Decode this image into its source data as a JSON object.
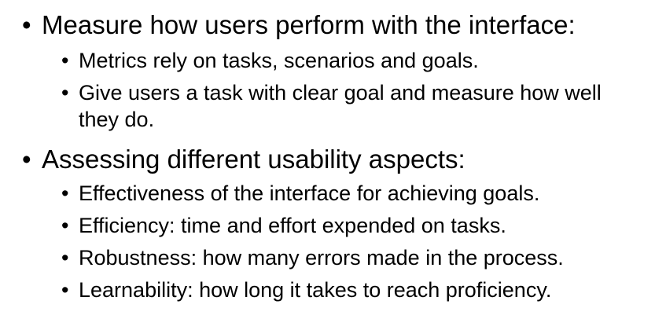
{
  "bullet_glyph": "•",
  "sections": [
    {
      "heading": "Measure how users perform with the interface:",
      "items": [
        "Metrics rely on tasks, scenarios and goals.",
        "Give users a task with clear goal and measure how well they do."
      ]
    },
    {
      "heading": "Assessing different usability aspects:",
      "items": [
        "Effectiveness of the interface for achieving goals.",
        "Efficiency: time and effort expended on tasks.",
        "Robustness: how many errors made in the process.",
        "Learnability: how long it takes to reach proficiency."
      ]
    }
  ]
}
